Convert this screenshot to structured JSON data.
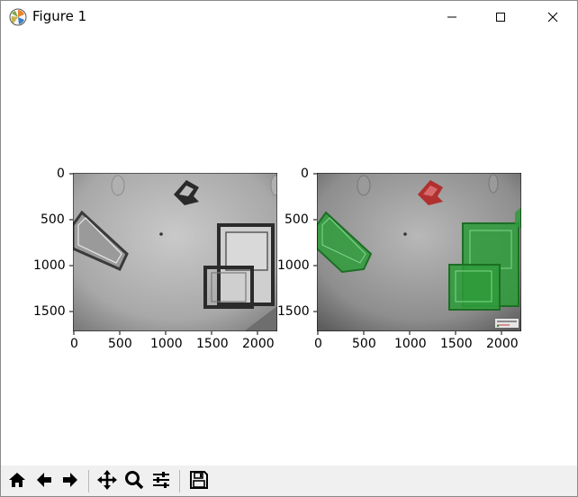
{
  "window": {
    "title": "Figure 1"
  },
  "icons": {
    "app": "matplotlib-logo-icon",
    "minimize": "minimize-icon",
    "maximize": "maximize-icon",
    "close": "close-icon"
  },
  "subplots": [
    {
      "name": "original-image",
      "x_ticks": [
        "0",
        "500",
        "1000",
        "1500",
        "2000"
      ],
      "y_ticks": [
        "0",
        "500",
        "1000",
        "1500"
      ],
      "x_range": [
        0,
        2200
      ],
      "y_range": [
        1700,
        0
      ]
    },
    {
      "name": "segmentation-overlay",
      "x_ticks": [
        "0",
        "500",
        "1000",
        "1500",
        "2000"
      ],
      "y_ticks": [
        "0",
        "500",
        "1000",
        "1500"
      ],
      "x_range": [
        0,
        2200
      ],
      "y_range": [
        1700,
        0
      ],
      "overlay_colors": {
        "class_a": "#2e9b3a",
        "class_b": "#b32424"
      }
    }
  ],
  "toolbar": {
    "buttons": [
      "home-icon",
      "back-icon",
      "forward-icon",
      "pan-icon",
      "zoom-icon",
      "configure-subplots-icon",
      "save-icon"
    ]
  }
}
